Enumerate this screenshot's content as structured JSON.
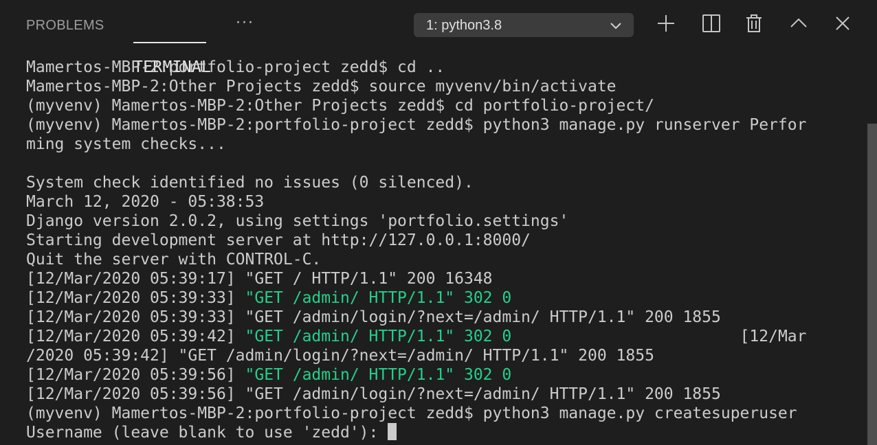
{
  "panel": {
    "tabs": [
      {
        "label": "PROBLEMS",
        "active": false
      },
      {
        "label": "TERMINAL",
        "active": true
      }
    ],
    "more_label": "···",
    "terminal_select": {
      "value": "1: python3.8"
    },
    "actions": [
      {
        "name": "new-terminal-button",
        "icon": "plus-icon"
      },
      {
        "name": "split-terminal-button",
        "icon": "split-icon"
      },
      {
        "name": "kill-terminal-button",
        "icon": "trash-icon"
      },
      {
        "name": "maximize-panel-button",
        "icon": "chevron-up-icon"
      },
      {
        "name": "close-panel-button",
        "icon": "close-icon"
      }
    ]
  },
  "colors": {
    "background": "#1e1e1e",
    "text": "#cccccc",
    "green": "#23d18b",
    "dropdown_bg": "#3c3c3c"
  },
  "terminal": {
    "lines": [
      [
        {
          "t": "Mamertos-MBP-2:portfolio-project zedd$ cd .."
        }
      ],
      [
        {
          "t": "Mamertos-MBP-2:Other Projects zedd$ source myvenv/bin/activate"
        }
      ],
      [
        {
          "t": "(myvenv) Mamertos-MBP-2:Other Projects zedd$ cd portfolio-project/"
        }
      ],
      [
        {
          "t": "(myvenv) Mamertos-MBP-2:portfolio-project zedd$ python3 manage.py runserver Perfor"
        }
      ],
      [
        {
          "t": "ming system checks..."
        }
      ],
      [
        {
          "t": ""
        }
      ],
      [
        {
          "t": "System check identified no issues (0 silenced)."
        }
      ],
      [
        {
          "t": "March 12, 2020 - 05:38:53"
        }
      ],
      [
        {
          "t": "Django version 2.0.2, using settings 'portfolio.settings'"
        }
      ],
      [
        {
          "t": "Starting development server at http://127.0.0.1:8000/"
        }
      ],
      [
        {
          "t": "Quit the server with CONTROL-C."
        }
      ],
      [
        {
          "t": "[12/Mar/2020 05:39:17] \"GET / HTTP/1.1\" 200 16348"
        }
      ],
      [
        {
          "t": "[12/Mar/2020 05:39:33] "
        },
        {
          "t": "\"GET /admin/ HTTP/1.1\" 302 0",
          "c": "green"
        }
      ],
      [
        {
          "t": "[12/Mar/2020 05:39:33] \"GET /admin/login/?next=/admin/ HTTP/1.1\" 200 1855"
        }
      ],
      [
        {
          "t": "[12/Mar/2020 05:39:42] "
        },
        {
          "t": "\"GET /admin/ HTTP/1.1\" 302 0",
          "c": "green"
        },
        {
          "t": "                        [12/Mar"
        }
      ],
      [
        {
          "t": "/2020 05:39:42] \"GET /admin/login/?next=/admin/ HTTP/1.1\" 200 1855"
        }
      ],
      [
        {
          "t": "[12/Mar/2020 05:39:56] "
        },
        {
          "t": "\"GET /admin/ HTTP/1.1\" 302 0",
          "c": "green"
        }
      ],
      [
        {
          "t": "[12/Mar/2020 05:39:56] \"GET /admin/login/?next=/admin/ HTTP/1.1\" 200 1855"
        }
      ],
      [
        {
          "t": "(myvenv) Mamertos-MBP-2:portfolio-project zedd$ python3 manage.py createsuperuser"
        }
      ]
    ],
    "prompt": "Username (leave blank to use 'zedd'): "
  }
}
